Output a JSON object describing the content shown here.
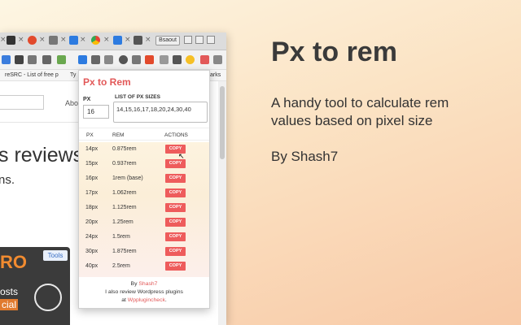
{
  "browser": {
    "bookmarks": [
      "reSRC - List of free p",
      "Ty",
      "arks"
    ],
    "window_label": "Bsaout"
  },
  "background_page": {
    "nav_item": "Abo",
    "heading": "s reviews",
    "subheading": "ns.",
    "card_logo": "RO",
    "card_tag": "Tools",
    "card_line1": "osts",
    "card_line2": "cial"
  },
  "popup": {
    "title": "Px to Rem",
    "px_label": "PX",
    "px_value": "16",
    "list_label": "LIST OF PX SIZES",
    "list_value": "14,15,16,17,18,20,24,30,40",
    "headers": {
      "px": "PX",
      "rem": "REM",
      "actions": "ACTIONS"
    },
    "rows": [
      {
        "px": "14px",
        "rem": "0.875rem",
        "action": "COPY"
      },
      {
        "px": "15px",
        "rem": "0.937rem",
        "action": "COPY"
      },
      {
        "px": "16px",
        "rem": "1rem",
        "note": "(base)",
        "action": "COPY"
      },
      {
        "px": "17px",
        "rem": "1.062rem",
        "action": "COPY"
      },
      {
        "px": "18px",
        "rem": "1.125rem",
        "action": "COPY"
      },
      {
        "px": "20px",
        "rem": "1.25rem",
        "action": "COPY"
      },
      {
        "px": "24px",
        "rem": "1.5rem",
        "action": "COPY"
      },
      {
        "px": "30px",
        "rem": "1.875rem",
        "action": "COPY"
      },
      {
        "px": "40px",
        "rem": "2.5rem",
        "action": "COPY"
      }
    ],
    "footer": {
      "by_prefix": "By ",
      "author": "Shash7",
      "line2": "I also review Wordpress plugins",
      "at_prefix": "at ",
      "site": "Wpplugincheck",
      "site_suffix": "."
    }
  },
  "marketing": {
    "headline": "Px to rem",
    "tagline": "A handy tool to calculate rem values based on pixel size",
    "byline": "By Shash7"
  },
  "colors": {
    "accent": "#e25858",
    "copy_button": "#ee5c5c"
  }
}
